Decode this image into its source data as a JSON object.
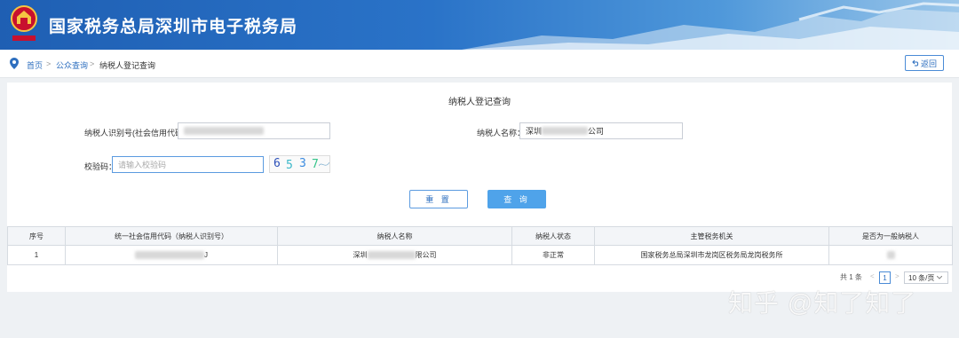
{
  "header": {
    "title": "国家税务总局深圳市电子税务局"
  },
  "breadcrumb": {
    "home": "首页",
    "public_query": "公众查询",
    "current": "纳税人登记查询",
    "sep": ">"
  },
  "back_button": {
    "label": "返回"
  },
  "panel": {
    "title": "纳税人登记查询"
  },
  "form": {
    "taxpayer_id_label": "纳税人识别号(社会信用代码)：",
    "taxpayer_name_label": "纳税人名称：",
    "taxpayer_name_prefix": "深圳",
    "taxpayer_name_suffix": "公司",
    "captcha_label": "校验码：",
    "captcha_placeholder": "请输入校验码",
    "captcha_chars": [
      "6",
      "5",
      "3",
      "7"
    ]
  },
  "buttons": {
    "reset": "重 置",
    "query": "查 询"
  },
  "table": {
    "columns": [
      "序号",
      "统一社会信用代码（纳税人识别号）",
      "纳税人名称",
      "纳税人状态",
      "主管税务机关",
      "是否为一般纳税人"
    ],
    "rows": [
      {
        "index": "1",
        "code_suffix": "J",
        "name_prefix": "深圳",
        "name_suffix": "限公司",
        "status": "非正常",
        "authority": "国家税务总局深圳市龙岗区税务局龙岗税务所"
      }
    ]
  },
  "pagination": {
    "total": "共 1 条",
    "page": "1",
    "page_size": "10 条/页"
  },
  "watermark": "知乎 @知了知了",
  "colors": {
    "brand_blue": "#2a73c8",
    "link": "#2e6fbf",
    "primary_button": "#4fa3ea"
  }
}
